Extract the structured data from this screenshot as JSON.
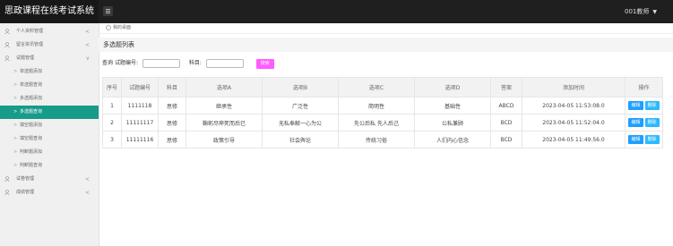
{
  "header": {
    "brand": "思政课程在线考试系统",
    "user": "001教师"
  },
  "sidebar": {
    "items": [
      {
        "label": "个人资料管理",
        "arrow": "<"
      },
      {
        "label": "留言资讯管理",
        "arrow": "<"
      },
      {
        "label": "试题管理",
        "arrow": "∨"
      }
    ],
    "sub_items": [
      {
        "label": "单选题添加"
      },
      {
        "label": "单选题查询"
      },
      {
        "label": "多选题添加"
      },
      {
        "label": "多选题查询"
      },
      {
        "label": "填空题添加"
      },
      {
        "label": "填空题查询"
      },
      {
        "label": "判断题添加"
      },
      {
        "label": "判断题查询"
      }
    ],
    "bottom_items": [
      {
        "label": "试卷管理",
        "arrow": "<"
      },
      {
        "label": "成绩管理",
        "arrow": "<"
      }
    ]
  },
  "breadcrumb": "我的桌面",
  "page_title": "多选题列表",
  "search": {
    "query_label": "查询",
    "code_label": "试题编号:",
    "subject_label": "科目:",
    "button": "搜索"
  },
  "table": {
    "headers": [
      "序号",
      "试题编号",
      "科目",
      "选项A",
      "选项B",
      "选项C",
      "选项D",
      "答案",
      "添加时间",
      "操作"
    ],
    "rows": [
      {
        "no": "1",
        "code": "1111118",
        "subject": "思修",
        "a": "继承性",
        "b": "广泛性",
        "c": "简明性",
        "d": "基础性",
        "answer": "ABCD",
        "time": "2023-04-05 11:53:08.0"
      },
      {
        "no": "2",
        "code": "11111117",
        "subject": "思修",
        "a": "鞠躬尽瘁死而后已",
        "b": "无私奉献一心为公",
        "c": "先公后私 先人后己",
        "d": "公私兼顾",
        "answer": "BCD",
        "time": "2023-04-05 11:52:04.0"
      },
      {
        "no": "3",
        "code": "11111116",
        "subject": "思修",
        "a": "政策引导",
        "b": "社会舆论",
        "c": "传统习俗",
        "d": "人们内心信念",
        "answer": "BCD",
        "time": "2023-04-05 11:49:56.0"
      }
    ],
    "edit_label": "编辑",
    "delete_label": "删除"
  },
  "colors": {
    "topbar": "#1f1f1f",
    "active_nav": "#179b8b",
    "search_button": "#ff5cff",
    "edit_button": "#1e9fff"
  }
}
